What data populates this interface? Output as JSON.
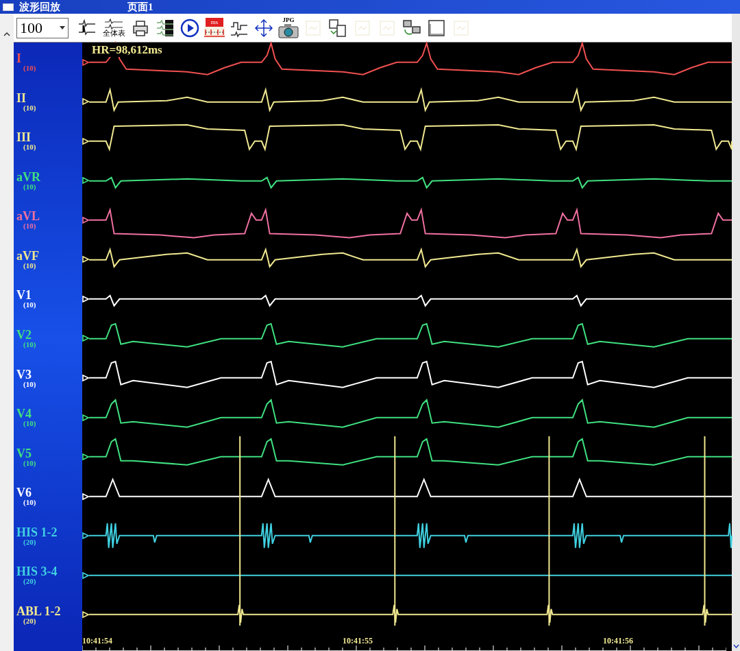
{
  "window": {
    "title": "波形回放",
    "page": "页面1"
  },
  "toolbar": {
    "zoom": "100",
    "buttons": [
      {
        "kind": "leads",
        "disabled": false
      },
      {
        "kind": "fullpage",
        "label": "全体表",
        "disabled": false
      },
      {
        "kind": "print",
        "disabled": false
      },
      {
        "kind": "stack",
        "disabled": false
      },
      {
        "kind": "play",
        "disabled": false
      },
      {
        "kind": "caliper",
        "label": "ms",
        "disabled": false
      },
      {
        "kind": "compare",
        "disabled": false
      },
      {
        "kind": "move",
        "disabled": false
      },
      {
        "kind": "camera",
        "label": "JPG",
        "disabled": false
      },
      {
        "kind": "blank",
        "disabled": true
      },
      {
        "kind": "save",
        "disabled": false
      },
      {
        "kind": "blank",
        "disabled": true
      },
      {
        "kind": "blank",
        "disabled": true
      },
      {
        "kind": "network",
        "disabled": false
      },
      {
        "kind": "window",
        "disabled": false
      },
      {
        "kind": "blank",
        "disabled": true
      }
    ]
  },
  "heart_rate": "HR=98,612ms",
  "channels": [
    {
      "name": "I",
      "gain": "(10)",
      "color": "#f05050",
      "kind": "surface"
    },
    {
      "name": "II",
      "gain": "(10)",
      "color": "#f0e890",
      "kind": "surface"
    },
    {
      "name": "III",
      "gain": "(10)",
      "color": "#f0e890",
      "kind": "surface"
    },
    {
      "name": "aVR",
      "gain": "(10)",
      "color": "#40e080",
      "kind": "surface"
    },
    {
      "name": "aVL",
      "gain": "(10)",
      "color": "#f070a0",
      "kind": "surface"
    },
    {
      "name": "aVF",
      "gain": "(10)",
      "color": "#f0e890",
      "kind": "surface"
    },
    {
      "name": "V1",
      "gain": "(10)",
      "color": "#ffffff",
      "kind": "surface"
    },
    {
      "name": "V2",
      "gain": "(10)",
      "color": "#40e080",
      "kind": "surface"
    },
    {
      "name": "V3",
      "gain": "(10)",
      "color": "#ffffff",
      "kind": "surface"
    },
    {
      "name": "V4",
      "gain": "(10)",
      "color": "#40e080",
      "kind": "surface"
    },
    {
      "name": "V5",
      "gain": "(10)",
      "color": "#40e080",
      "kind": "surface"
    },
    {
      "name": "V6",
      "gain": "(10)",
      "color": "#ffffff",
      "kind": "surface"
    },
    {
      "name": "HIS 1-2",
      "gain": "(20)",
      "color": "#40d0e0",
      "kind": "his"
    },
    {
      "name": "HIS 3-4",
      "gain": "(20)",
      "color": "#40d0e0",
      "kind": "flat"
    },
    {
      "name": "ABL 1-2",
      "gain": "(20)",
      "color": "#f0e890",
      "kind": "ablation"
    }
  ],
  "time_axis": [
    "10:41:54",
    "10:41:55",
    "10:41:56"
  ]
}
